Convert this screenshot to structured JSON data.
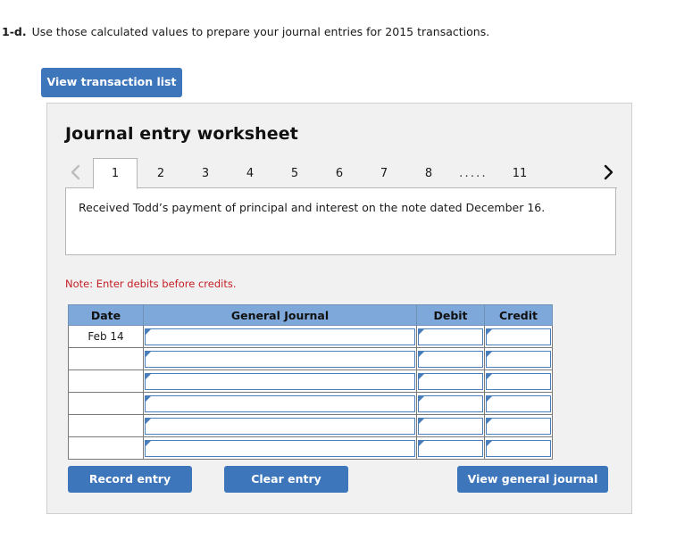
{
  "question": {
    "number": "1-d.",
    "text": "Use those calculated values to prepare your journal entries for 2015 transactions."
  },
  "toolbar": {
    "view_transaction_list_label": "View transaction list"
  },
  "worksheet": {
    "title": "Journal entry worksheet",
    "prev_icon": "chevron-left-icon",
    "next_icon": "chevron-right-icon",
    "prev_enabled": false,
    "next_enabled": true,
    "tabs": [
      {
        "label": "1",
        "active": true
      },
      {
        "label": "2",
        "active": false
      },
      {
        "label": "3",
        "active": false
      },
      {
        "label": "4",
        "active": false
      },
      {
        "label": "5",
        "active": false
      },
      {
        "label": "6",
        "active": false
      },
      {
        "label": "7",
        "active": false
      },
      {
        "label": "8",
        "active": false
      }
    ],
    "ellipsis": ".....",
    "last_tab": "11",
    "description": "Received Todd’s payment of principal and interest on the note dated December 16.",
    "note": "Note: Enter debits before credits."
  },
  "journal_table": {
    "headers": [
      "Date",
      "General Journal",
      "Debit",
      "Credit"
    ],
    "rows": [
      {
        "date": "Feb 14",
        "general_journal": "",
        "debit": "",
        "credit": ""
      },
      {
        "date": "",
        "general_journal": "",
        "debit": "",
        "credit": ""
      },
      {
        "date": "",
        "general_journal": "",
        "debit": "",
        "credit": ""
      },
      {
        "date": "",
        "general_journal": "",
        "debit": "",
        "credit": ""
      },
      {
        "date": "",
        "general_journal": "",
        "debit": "",
        "credit": ""
      },
      {
        "date": "",
        "general_journal": "",
        "debit": "",
        "credit": ""
      }
    ]
  },
  "actions": {
    "record_entry_label": "Record entry",
    "clear_entry_label": "Clear entry",
    "view_general_journal_label": "View general journal"
  },
  "colors": {
    "button_blue": "#3d76bb",
    "table_header_blue": "#7da8d9",
    "note_red": "#c32027",
    "panel_gray": "#f1f1f1",
    "field_border_blue": "#4a7ebb"
  }
}
